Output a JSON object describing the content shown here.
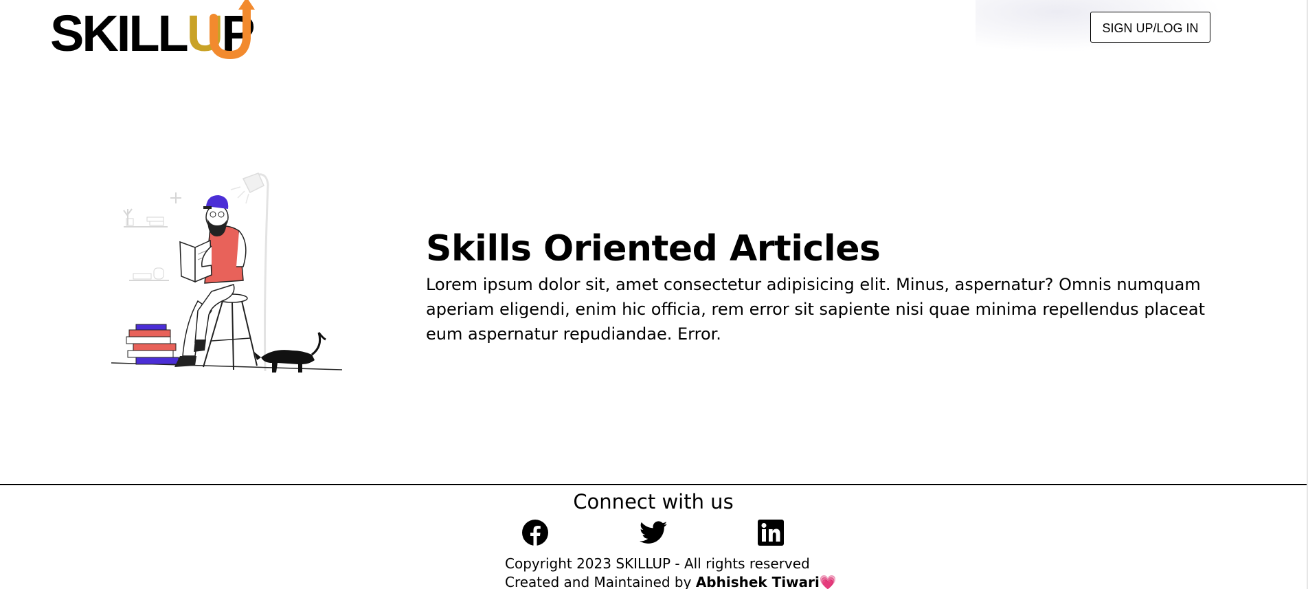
{
  "header": {
    "logo_prefix": "SKILL",
    "logo_u": "U",
    "logo_suffix": "P",
    "signup_label": "SIGN UP/LOG IN"
  },
  "hero": {
    "title": "Skills Oriented Articles",
    "body": "Lorem ipsum dolor sit, amet consectetur adipisicing elit. Minus, aspernatur? Omnis numquam aperiam eligendi, enim hic officia, rem error sit sapiente nisi quae minima repellendus placeat eum aspernatur repudiandae. Error.",
    "illustration_icon": "reading-man-with-cat-illustration"
  },
  "footer": {
    "heading": "Connect with us",
    "social": [
      {
        "icon": "facebook-icon"
      },
      {
        "icon": "twitter-icon"
      },
      {
        "icon": "linkedin-icon"
      }
    ],
    "copyright": "Copyright 2023 SKILLUP - All rights reserved",
    "credit_prefix": "Created and Maintained by ",
    "credit_name": "Abhishek Tiwari",
    "heart": "💗"
  },
  "colors": {
    "logo_u": "#c9a227",
    "logo_arrow": "#f28a2e",
    "heart": "#ec3a6e",
    "shirt": "#e8625a",
    "cap": "#4b2ed6"
  }
}
